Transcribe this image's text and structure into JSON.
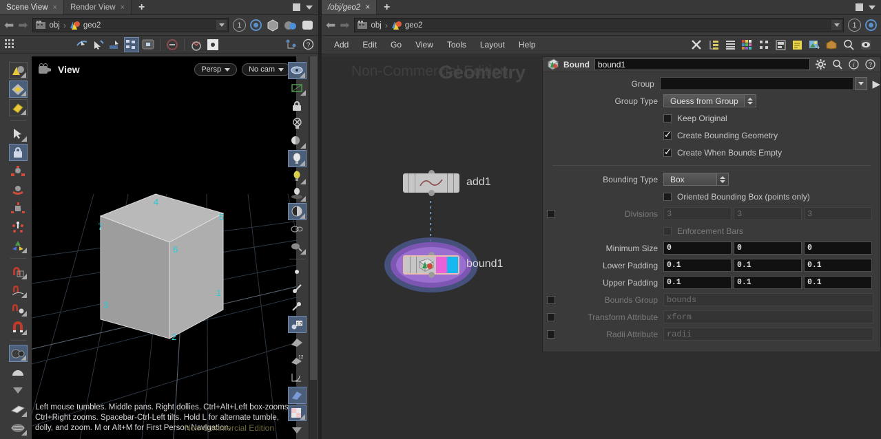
{
  "left_pane": {
    "tabs": [
      {
        "label": "Scene View",
        "active": true,
        "close": "×"
      },
      {
        "label": "Render View",
        "active": false,
        "close": "×"
      }
    ],
    "tab_add": "+",
    "path": {
      "node_icon": "obj-icon",
      "seg1": "obj",
      "sep": "›",
      "seg2": "geo2",
      "frame": "1"
    },
    "viewport": {
      "title": "View",
      "view_mode": "Persp",
      "camera": "No cam",
      "help_text": "Left mouse tumbles. Middle pans. Right dollies. Ctrl+Alt+Left box-zooms. Ctrl+Right zooms. Spacebar-Ctrl-Left tilts. Hold L for alternate tumble, dolly, and zoom. M or Alt+M for First Person Navigation.",
      "watermark": "Non-Commercial Edition",
      "point_numbers": [
        "1",
        "2",
        "3",
        "4",
        "5",
        "6",
        "7"
      ]
    }
  },
  "right_pane": {
    "tabs": [
      {
        "label": "/obj/geo2",
        "close": "×"
      }
    ],
    "tab_add": "+",
    "menus": [
      "Add",
      "Edit",
      "Go",
      "View",
      "Tools",
      "Layout",
      "Help"
    ],
    "network": {
      "watermark_left": "Non-Commercial Edition",
      "watermark_title": "Geometry",
      "nodes": [
        {
          "name": "add1",
          "type": "add",
          "selected": false
        },
        {
          "name": "bound1",
          "type": "bound",
          "selected": true
        }
      ]
    },
    "path": {
      "seg1": "obj",
      "sep": "›",
      "seg2": "geo2",
      "frame": "1"
    }
  },
  "parameters": {
    "node_type_label": "Bound",
    "node_name": "bound1",
    "rows": {
      "group": {
        "label": "Group",
        "value": "",
        "placeholder": ""
      },
      "group_type": {
        "label": "Group Type",
        "value": "Guess from Group"
      },
      "keep_original": {
        "label": "Keep Original",
        "checked": false
      },
      "create_bounding_geometry": {
        "label": "Create Bounding Geometry",
        "checked": true
      },
      "create_when_bounds_empty": {
        "label": "Create When Bounds Empty",
        "checked": true
      },
      "bounding_type": {
        "label": "Bounding Type",
        "value": "Box"
      },
      "oriented_bbox": {
        "label": "Oriented Bounding Box (points only)",
        "checked": false
      },
      "divisions": {
        "label": "Divisions",
        "enabled": false,
        "values": [
          "3",
          "3",
          "3"
        ]
      },
      "enforcement_bars": {
        "label": "Enforcement Bars",
        "checked": false,
        "enabled": false
      },
      "minimum_size": {
        "label": "Minimum Size",
        "values": [
          "0",
          "0",
          "0"
        ]
      },
      "lower_padding": {
        "label": "Lower Padding",
        "values": [
          "0.1",
          "0.1",
          "0.1"
        ]
      },
      "upper_padding": {
        "label": "Upper Padding",
        "values": [
          "0.1",
          "0.1",
          "0.1"
        ]
      },
      "bounds_group": {
        "label": "Bounds Group",
        "value": "bounds",
        "enabled": false
      },
      "transform_attribute": {
        "label": "Transform Attribute",
        "value": "xform",
        "enabled": false
      },
      "radii_attribute": {
        "label": "Radii Attribute",
        "value": "radii",
        "enabled": false
      }
    }
  },
  "colors": {
    "accent_selected": "#4b5f7b",
    "node_flag_magenta": "#e861d8",
    "node_flag_cyan": "#15b7f0",
    "selection_ring": "#8f5fc0",
    "point_number": "#2ec8d8",
    "watermark": "#6e6a3a"
  }
}
